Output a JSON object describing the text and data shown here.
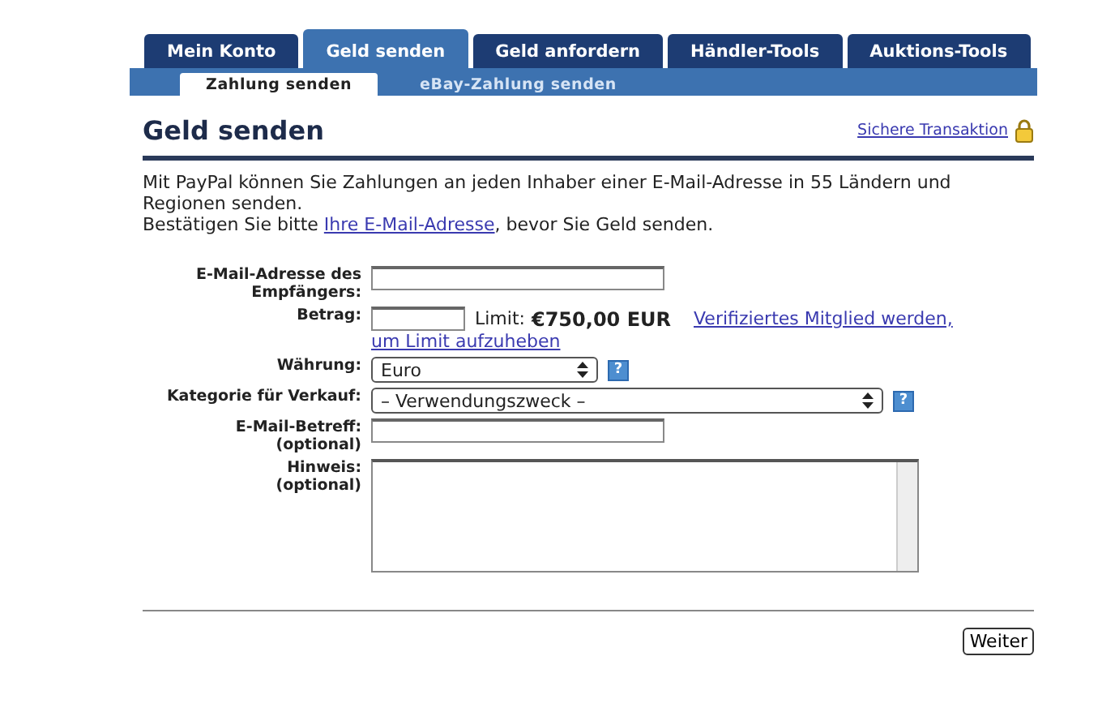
{
  "tabs": [
    {
      "label": "Mein Konto",
      "selected": false
    },
    {
      "label": "Geld senden",
      "selected": true
    },
    {
      "label": "Geld anfordern",
      "selected": false
    },
    {
      "label": "Händler-Tools",
      "selected": false
    },
    {
      "label": "Auktions-Tools",
      "selected": false
    }
  ],
  "subtabs": [
    {
      "label": "Zahlung senden",
      "selected": true
    },
    {
      "label": "eBay-Zahlung senden",
      "selected": false
    }
  ],
  "heading": "Geld senden",
  "secure_link": "Sichere Transaktion",
  "intro": "Mit PayPal können Sie Zahlungen an jeden Inhaber einer E-Mail-Adresse in 55 Ländern und Regionen senden.",
  "confirm": {
    "before": "Bestätigen Sie bitte ",
    "link": "Ihre E-Mail-Adresse",
    "after": ", bevor Sie Geld senden."
  },
  "form": [
    {
      "kind": "text",
      "label": "E-Mail-Adresse des Empfängers:"
    },
    {
      "kind": "amount",
      "label": "Betrag:",
      "limit_label": "Limit:",
      "limit_value": "€750,00 EUR",
      "link_lines": [
        "Verifiziertes Mitglied werden,",
        "um Limit aufzuheben"
      ]
    },
    {
      "kind": "select",
      "label": "Währung:",
      "value": "Euro",
      "help": "?"
    },
    {
      "kind": "wideselect",
      "label": "Kategorie für Verkauf:",
      "value": "– Verwendungszweck –",
      "help": "?"
    },
    {
      "kind": "text",
      "label": "E-Mail-Betreff:",
      "sublabel": "(optional)"
    },
    {
      "kind": "textarea",
      "label": "Hinweis:",
      "sublabel": "(optional)"
    }
  ],
  "submit": "Weiter"
}
